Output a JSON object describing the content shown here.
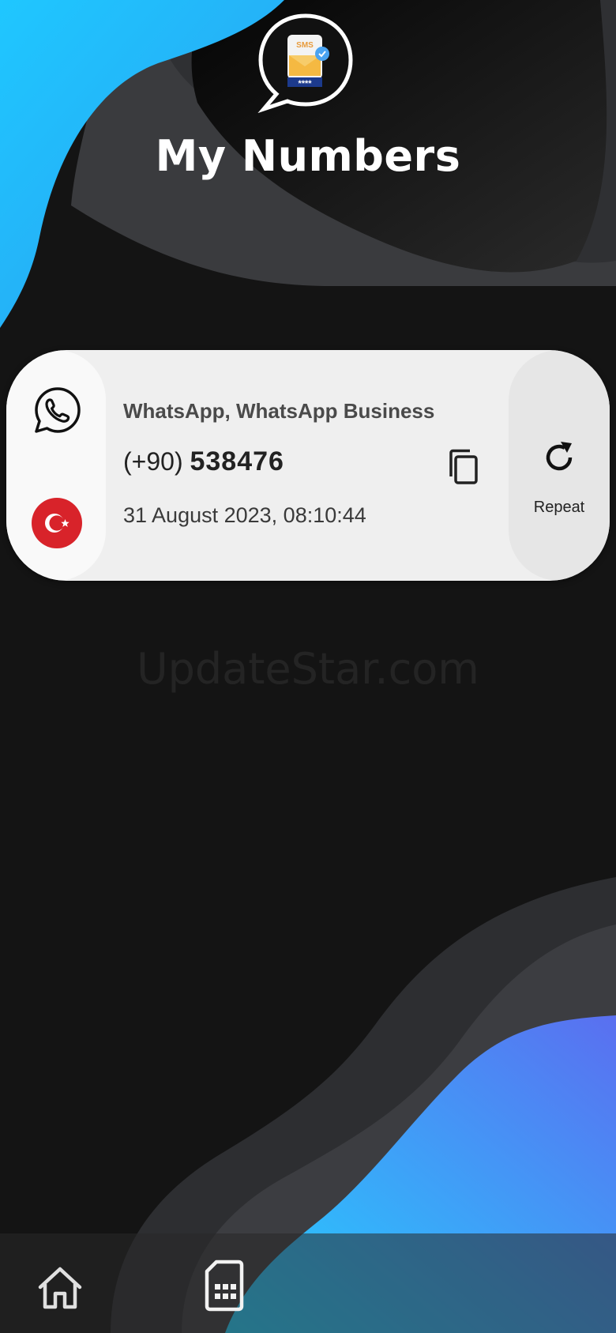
{
  "header": {
    "title": "My Numbers",
    "logo": {
      "icon": "sms-sim-chat-icon",
      "sms_text": "SMS",
      "code_mask": "****"
    }
  },
  "numbers": [
    {
      "service": "WhatsApp, WhatsApp Business",
      "service_icon": "whatsapp-icon",
      "country_flag": "turkey-flag-icon",
      "dial_code": "(+90)",
      "number": "538476",
      "timestamp": "31 August 2023, 08:10:44",
      "copy_icon": "copy-icon",
      "repeat_label": "Repeat",
      "repeat_icon": "refresh-icon"
    }
  ],
  "watermark": "UpdateStar.com",
  "bottom_nav": {
    "items": [
      {
        "name": "home",
        "icon": "home-icon"
      },
      {
        "name": "my-numbers",
        "icon": "sim-card-icon"
      }
    ]
  },
  "colors": {
    "background": "#141414",
    "accent_blue": "#29b6f6",
    "accent_purple": "#5a6ff0",
    "card": "#efefef",
    "flag_red": "#d8232a"
  }
}
